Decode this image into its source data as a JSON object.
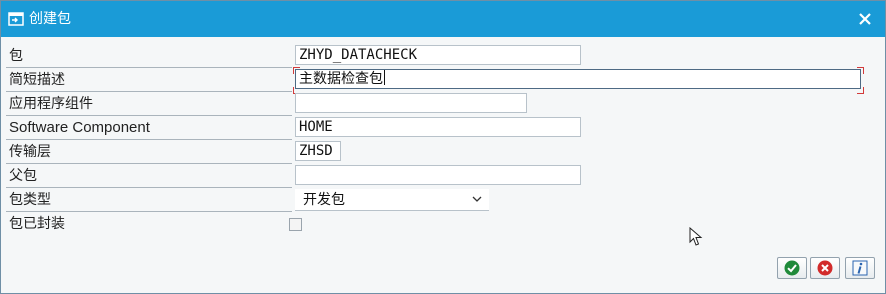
{
  "window": {
    "title": "创建包",
    "icons": {
      "title": "new-entry-icon",
      "close": "close-icon"
    }
  },
  "form": {
    "package": {
      "label": "包",
      "value": "ZHYD_DATACHECK"
    },
    "short_description": {
      "label": "简短描述",
      "value": "主数据检查包"
    },
    "application_component": {
      "label": "应用程序组件",
      "value": ""
    },
    "software_component": {
      "label": "Software Component",
      "value": "HOME"
    },
    "transport_layer": {
      "label": "传输层",
      "value": "ZHSD"
    },
    "parent_package": {
      "label": "父包",
      "value": ""
    },
    "package_type": {
      "label": "包类型",
      "value": "开发包"
    },
    "package_encapsulated": {
      "label": "包已封装",
      "checked": false
    }
  },
  "buttons": {
    "continue": {
      "icon": "check-icon",
      "color": "#1f8a3a"
    },
    "cancel": {
      "icon": "cancel-icon",
      "color": "#d22b2b"
    },
    "info": {
      "icon": "info-icon",
      "color": "#2a64b0"
    }
  },
  "colors": {
    "titlebar": "#1a9bd7",
    "background": "#f5f7f8"
  }
}
